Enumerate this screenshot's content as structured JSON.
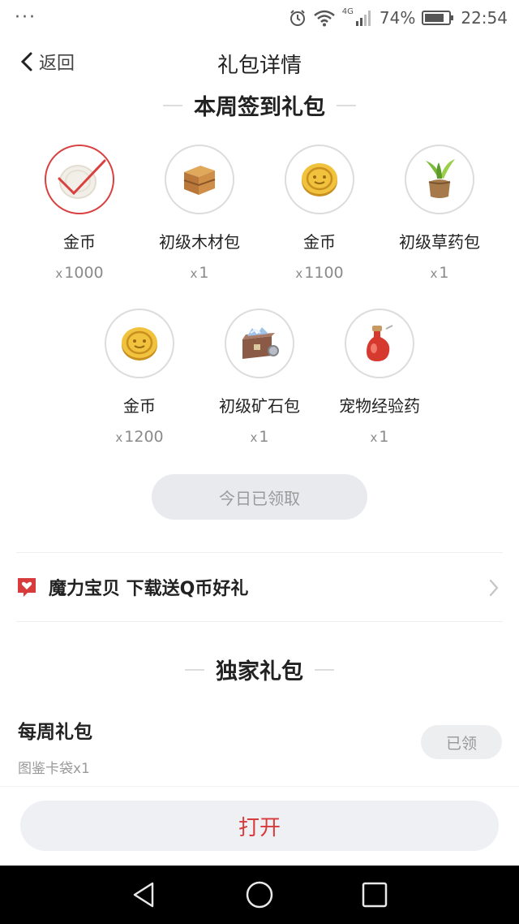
{
  "status_bar": {
    "left": "···",
    "network": "4G",
    "battery": "74%",
    "time": "22:54"
  },
  "nav": {
    "back_label": "返回",
    "title": "礼包详情"
  },
  "weekly_signin": {
    "heading": "本周签到礼包",
    "items": [
      {
        "name": "金币",
        "qty_prefix": "x",
        "qty": "1000",
        "icon": "coin-claimed-icon"
      },
      {
        "name": "初级木材包",
        "qty_prefix": "x",
        "qty": "1",
        "icon": "wood-crate-icon"
      },
      {
        "name": "金币",
        "qty_prefix": "x",
        "qty": "1100",
        "icon": "gold-coin-icon"
      },
      {
        "name": "初级草药包",
        "qty_prefix": "x",
        "qty": "1",
        "icon": "herb-bag-icon"
      },
      {
        "name": "金币",
        "qty_prefix": "x",
        "qty": "1200",
        "icon": "gold-coin-icon"
      },
      {
        "name": "初级矿石包",
        "qty_prefix": "x",
        "qty": "1",
        "icon": "ore-chest-icon"
      },
      {
        "name": "宠物经验药",
        "qty_prefix": "x",
        "qty": "1",
        "icon": "potion-icon"
      }
    ],
    "claim_button": "今日已领取"
  },
  "promo": {
    "text": "魔力宝贝 下载送Q币好礼",
    "icon": "heart-chat-icon"
  },
  "exclusive": {
    "heading": "独家礼包",
    "weekly": {
      "title": "每周礼包",
      "desc": "图鉴卡袋x1",
      "badge": "已领"
    }
  },
  "open_button": "打开",
  "colors": {
    "accent_red": "#d73b3b",
    "disabled_bg": "#e9eaee",
    "muted_text": "#9a9a9a"
  }
}
